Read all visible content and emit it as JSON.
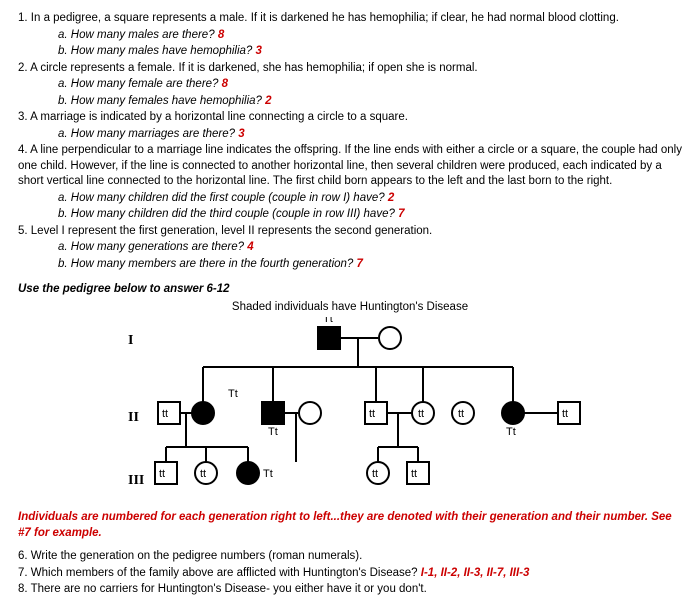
{
  "q1": {
    "text": "1. In a pedigree, a square represents a male. If it is darkened he has hemophilia; if clear, he had normal blood clotting.",
    "a_q": "a. How many males are there?",
    "a_ans": "8",
    "b_q": "b. How many males have hemophilia?",
    "b_ans": "3"
  },
  "q2": {
    "text": "2. A circle represents a female. If it is darkened, she has hemophilia; if open she is normal.",
    "a_q": "a. How many female are there?",
    "a_ans": "8",
    "b_q": "b. How many females have hemophilia?",
    "b_ans": "2"
  },
  "q3": {
    "text": "3. A marriage is indicated by a horizontal line connecting a circle to a square.",
    "a_q": "a. How many marriages are there?",
    "a_ans": "3"
  },
  "q4": {
    "text": "4. A line perpendicular to a marriage line indicates the offspring. If the line ends with either a circle or a square, the couple had only one child. However, if the line is connected to another horizontal line, then several children were produced, each indicated by a short vertical line connected to the horizontal line. The first child born appears to the left and the last born to the right.",
    "a_q": "a. How many children did the first couple (couple in row I) have?",
    "a_ans": "2",
    "b_q": "b. How many children did the third couple (couple in row III) have?",
    "b_ans": "7"
  },
  "q5": {
    "text": "5. Level I represent the first generation, level II represents the second generation.",
    "a_q": "a. How many generations are there?",
    "a_ans": "4",
    "b_q": "b. How many members are there in the fourth generation?",
    "b_ans": "7"
  },
  "instruction": "Use the pedigree below to answer 6-12",
  "pedigree_title": "Shaded individuals have Huntington's Disease",
  "red_note": "Individuals are numbered for each generation right to left...they are denoted with their generation and their number.  See #7 for example.",
  "q6": "6. Write the generation on the pedigree numbers (roman numerals).",
  "q7": {
    "text": "7. Which members of the family above are afflicted with Huntington's Disease?",
    "ans": "I-1, II-2, II-3, II-7, III-3"
  },
  "q8": "8. There are no carriers for Huntington's Disease- you either have it or you don't.",
  "genotype": "Tt",
  "gen_labels": {
    "I": "I",
    "II": "II",
    "III": "III"
  }
}
